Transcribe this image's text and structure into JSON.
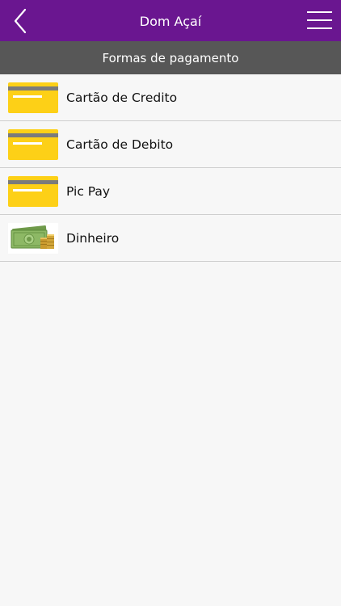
{
  "header": {
    "title": "Dom Açaí",
    "back_icon": "chevron-left-icon",
    "menu_icon": "hamburger-menu-icon"
  },
  "section": {
    "title": "Formas de pagamento"
  },
  "payment_methods": [
    {
      "label": "Cartão de Credito",
      "icon": "credit-card-icon"
    },
    {
      "label": "Cartão de Debito",
      "icon": "debit-card-icon"
    },
    {
      "label": "Pic Pay",
      "icon": "picpay-card-icon"
    },
    {
      "label": "Dinheiro",
      "icon": "cash-money-icon"
    }
  ],
  "colors": {
    "topbar": "#6a1690",
    "section_header": "#575757",
    "card_yellow": "#fdd017",
    "card_stripe": "#7b7b7b",
    "background": "#f7f7f7"
  }
}
